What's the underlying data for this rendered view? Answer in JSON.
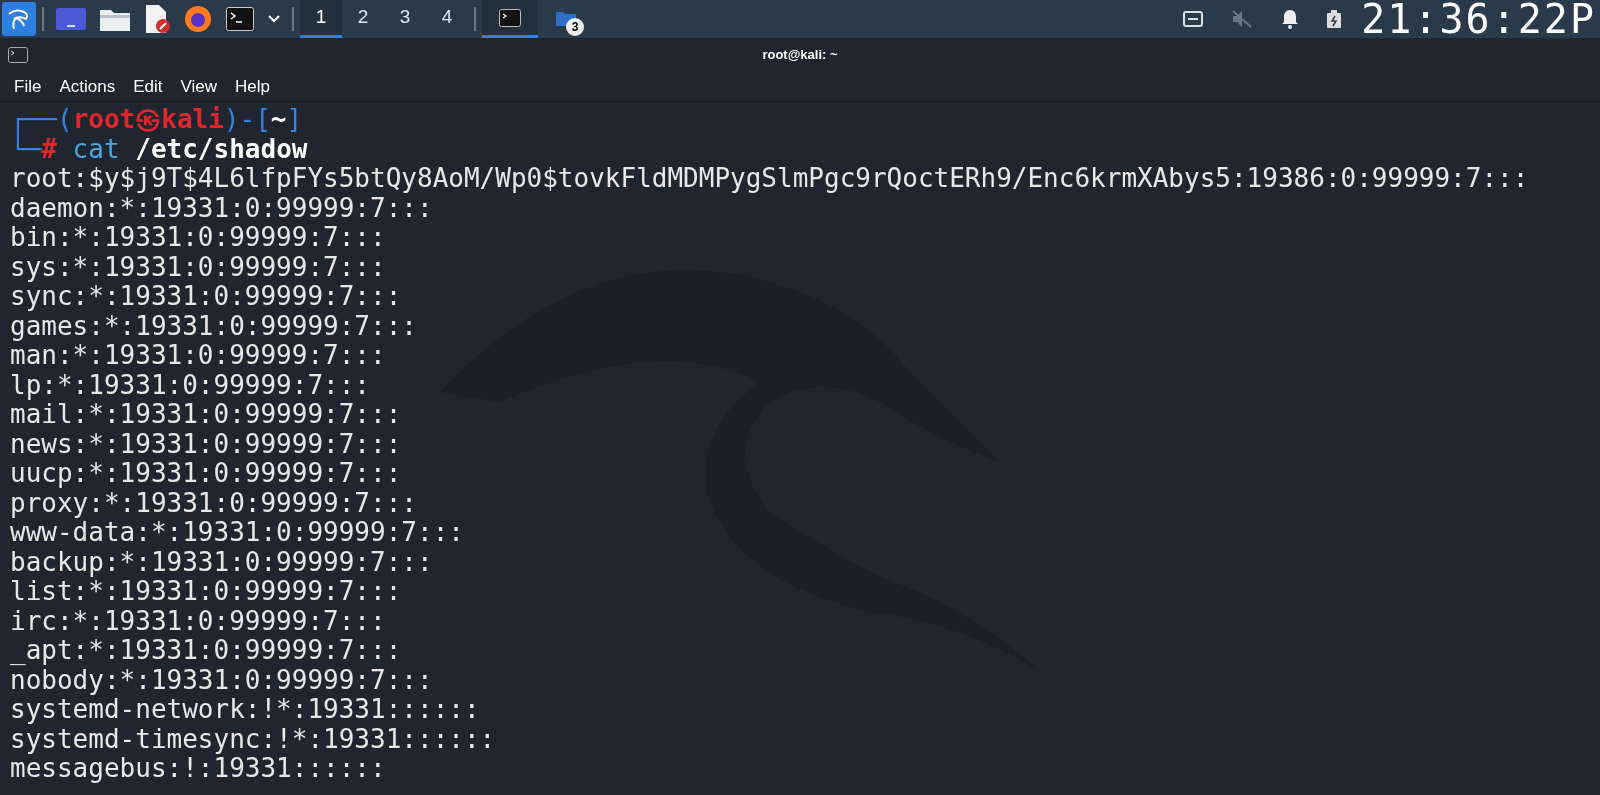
{
  "taskbar": {
    "workspaces": [
      {
        "label": "1",
        "selected": true
      },
      {
        "label": "2",
        "selected": false
      },
      {
        "label": "3",
        "selected": false
      },
      {
        "label": "4",
        "selected": false
      }
    ],
    "tasks": [
      {
        "kind": "terminal",
        "selected": true
      },
      {
        "kind": "folder",
        "selected": false,
        "badge": "3"
      }
    ],
    "clock": "21:36:22P"
  },
  "window": {
    "title": "root@kali: ~"
  },
  "menu": [
    "File",
    "Actions",
    "Edit",
    "View",
    "Help"
  ],
  "terminal": {
    "prompt": [
      [
        {
          "text": "┌──(",
          "kind": "frame"
        },
        {
          "text": "root㉿kali",
          "kind": "user"
        },
        {
          "text": ")-[",
          "kind": "frame"
        },
        {
          "text": "~",
          "kind": "dir"
        },
        {
          "text": "]",
          "kind": "frame"
        }
      ],
      [
        {
          "text": "└─",
          "kind": "frame"
        },
        {
          "text": "#",
          "kind": "user"
        },
        {
          "text": " cat",
          "kind": "cmd"
        },
        {
          "text": " /etc/shadow",
          "kind": "dir"
        }
      ]
    ],
    "output": [
      "root:$y$j9T$4L6lfpFYs5btQy8AoM/Wp0$tovkFldMDMPygSlmPgc9rQoctERh9/Enc6krmXAbys5:19386:0:99999:7:::",
      "daemon:*:19331:0:99999:7:::",
      "bin:*:19331:0:99999:7:::",
      "sys:*:19331:0:99999:7:::",
      "sync:*:19331:0:99999:7:::",
      "games:*:19331:0:99999:7:::",
      "man:*:19331:0:99999:7:::",
      "lp:*:19331:0:99999:7:::",
      "mail:*:19331:0:99999:7:::",
      "news:*:19331:0:99999:7:::",
      "uucp:*:19331:0:99999:7:::",
      "proxy:*:19331:0:99999:7:::",
      "www-data:*:19331:0:99999:7:::",
      "backup:*:19331:0:99999:7:::",
      "list:*:19331:0:99999:7:::",
      "irc:*:19331:0:99999:7:::",
      "_apt:*:19331:0:99999:7:::",
      "nobody:*:19331:0:99999:7:::",
      "systemd-network:!*:19331::::::",
      "systemd-timesync:!*:19331::::::",
      "messagebus:!:19331::::::"
    ]
  }
}
